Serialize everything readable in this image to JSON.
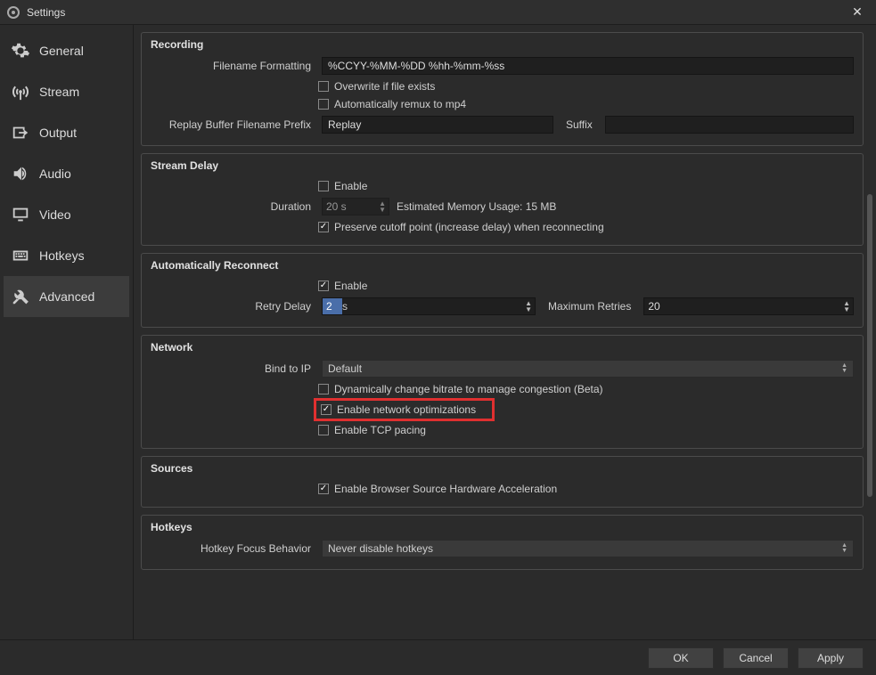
{
  "window": {
    "title": "Settings"
  },
  "sidebar": {
    "items": [
      {
        "id": "general",
        "label": "General"
      },
      {
        "id": "stream",
        "label": "Stream"
      },
      {
        "id": "output",
        "label": "Output"
      },
      {
        "id": "audio",
        "label": "Audio"
      },
      {
        "id": "video",
        "label": "Video"
      },
      {
        "id": "hotkeys",
        "label": "Hotkeys"
      },
      {
        "id": "advanced",
        "label": "Advanced"
      }
    ],
    "active": "advanced"
  },
  "recording": {
    "title": "Recording",
    "filename_formatting_label": "Filename Formatting",
    "filename_formatting_value": "%CCYY-%MM-%DD %hh-%mm-%ss",
    "overwrite_label": "Overwrite if file exists",
    "overwrite_checked": false,
    "autoremux_label": "Automatically remux to mp4",
    "autoremux_checked": false,
    "replay_prefix_label": "Replay Buffer Filename Prefix",
    "replay_prefix_value": "Replay",
    "suffix_label": "Suffix",
    "suffix_value": ""
  },
  "stream_delay": {
    "title": "Stream Delay",
    "enable_label": "Enable",
    "enable_checked": false,
    "duration_label": "Duration",
    "duration_value": "20 s",
    "usage_label": "Estimated Memory Usage: 15 MB",
    "preserve_label": "Preserve cutoff point (increase delay) when reconnecting",
    "preserve_checked": true
  },
  "auto_reconnect": {
    "title": "Automatically Reconnect",
    "enable_label": "Enable",
    "enable_checked": true,
    "retry_delay_label": "Retry Delay",
    "retry_delay_value": "2",
    "retry_delay_unit": "s",
    "max_retries_label": "Maximum Retries",
    "max_retries_value": "20"
  },
  "network": {
    "title": "Network",
    "bind_ip_label": "Bind to IP",
    "bind_ip_value": "Default",
    "dyn_bitrate_label": "Dynamically change bitrate to manage congestion (Beta)",
    "dyn_bitrate_checked": false,
    "net_optim_label": "Enable network optimizations",
    "net_optim_checked": true,
    "tcp_pacing_label": "Enable TCP pacing",
    "tcp_pacing_checked": false
  },
  "sources": {
    "title": "Sources",
    "browser_accel_label": "Enable Browser Source Hardware Acceleration",
    "browser_accel_checked": true
  },
  "hotkeys": {
    "title": "Hotkeys",
    "focus_behavior_label": "Hotkey Focus Behavior",
    "focus_behavior_value": "Never disable hotkeys"
  },
  "footer": {
    "ok": "OK",
    "cancel": "Cancel",
    "apply": "Apply"
  }
}
